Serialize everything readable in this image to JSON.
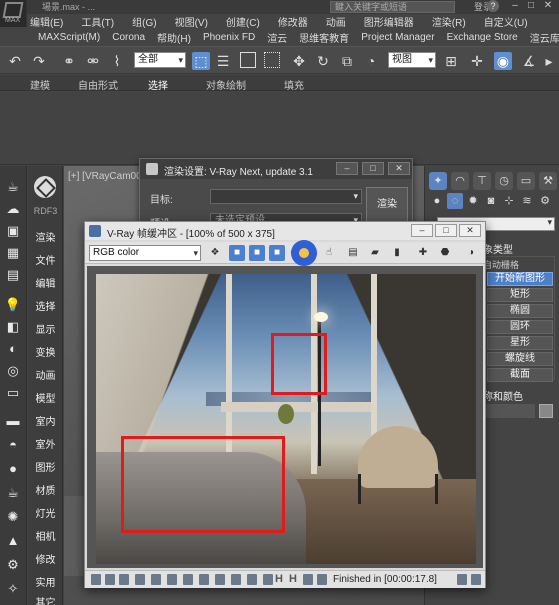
{
  "window": {
    "title": "場景.max - ...",
    "search_placeholder": "鍵入关键字或短语",
    "login": "登录",
    "help": "?"
  },
  "app": {
    "logo": "MAX"
  },
  "menu": {
    "row1": [
      "编辑(E)",
      "工具(T)",
      "组(G)",
      "视图(V)",
      "创建(C)",
      "修改器",
      "动画",
      "图形编辑器",
      "渲染(R)",
      "自定义(U)"
    ],
    "row2": [
      "MAXScript(M)",
      "Corona",
      "帮助(H)",
      "Phoenix FD",
      "渲云",
      "思维客教育",
      "Project Manager",
      "Exchange Store",
      "渲云库"
    ]
  },
  "toolbar": {
    "selection_filter": "全部",
    "reference_coord": "视图"
  },
  "ribbon": {
    "tabs": [
      "建模",
      "自由形式",
      "选择",
      "对象绘制",
      "填充"
    ],
    "selected": "选择"
  },
  "left_strip_icons": [
    "teapot-icon",
    "cloud-icon",
    "monitor-icon",
    "grid-icon",
    "frame-icon",
    "light-icon",
    "camera-icon",
    "curve-icon",
    "target-icon",
    "film-icon",
    "folder-icon",
    "dome-icon",
    "sphere-icon",
    "teapot2-icon",
    "sun-icon",
    "flame-icon",
    "gear-icon",
    "fx-icon"
  ],
  "left_panel": {
    "brand": "RDF3",
    "items": [
      "渲染",
      "文件",
      "编辑",
      "选择",
      "显示",
      "变换",
      "动画",
      "模型",
      "室内",
      "室外",
      "图形",
      "材质",
      "灯光",
      "相机",
      "修改",
      "实用",
      "其它"
    ]
  },
  "viewport": {
    "label": "[+] [VRayCam001 ]"
  },
  "command_panel": {
    "section_title": "象类型",
    "autogrid": "自动栅格",
    "buttons": [
      "开始新图形",
      "矩形",
      "椭圆",
      "圆环",
      "星形",
      "螺旋线",
      "截面"
    ],
    "active_button": "开始新图形",
    "color_section": "称和颜色"
  },
  "render_setup": {
    "title": "渲染设置: V-Ray Next, update 3.1",
    "target_label": "目标:",
    "preset_label": "预设:",
    "preset_value": "未选定预设",
    "render_button": "渲染"
  },
  "vfb": {
    "title": "V-Ray 帧缓冲区 - [100% of 500 x 375]",
    "channel": "RGB color",
    "status": "Finished in [00:00:17.8]"
  },
  "colors": {
    "highlight_red": "#e01b1b",
    "active_blue": "#4e7fc9"
  }
}
